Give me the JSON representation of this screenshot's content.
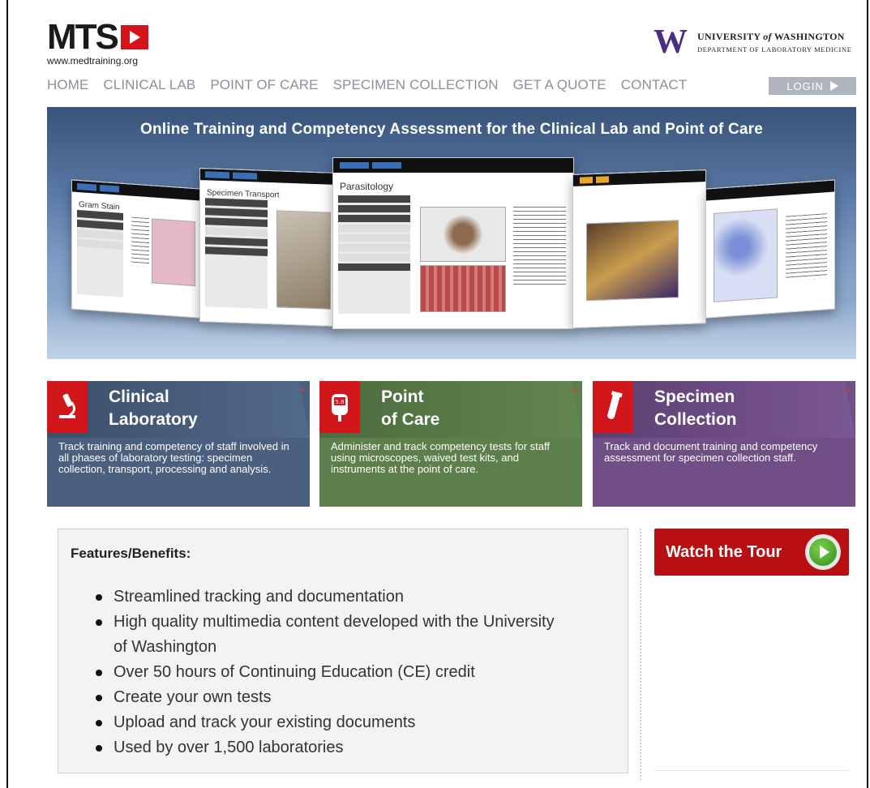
{
  "header": {
    "logo_text": "MTS",
    "logo_url": "www.medtraining.org",
    "uw_mark": "W",
    "uw_name_pre": "UNIVERSITY ",
    "uw_name_of": "of",
    "uw_name_post": " WASHINGTON",
    "uw_dept": "DEPARTMENT OF LABORATORY MEDICINE"
  },
  "nav": {
    "items": [
      "HOME",
      "CLINICAL LAB",
      "POINT OF CARE",
      "SPECIMEN COLLECTION",
      "GET A QUOTE",
      "CONTACT"
    ],
    "login_label": "LOGIN"
  },
  "hero": {
    "title": "Online Training and Competency Assessment for the Clinical Lab and Point of Care",
    "screens": [
      "Gram Stain",
      "Specimen Transport",
      "Parasitology"
    ]
  },
  "tiles": [
    {
      "title_1": "Clinical",
      "title_2": "Laboratory",
      "icon": "microscope-icon",
      "desc": "Track training and competency of staff involved in all phases of laboratory testing: specimen collection, transport, processing and analysis."
    },
    {
      "title_1": "Point",
      "title_2": "of Care",
      "icon": "glucometer-icon",
      "icon_text": "5.8",
      "desc": "Administer and track competency tests for staff using microscopes, waived test kits, and instruments at the point of care."
    },
    {
      "title_1": "Specimen",
      "title_2": "Collection",
      "icon": "test-tube-icon",
      "desc": "Track and document training and competency assessment for specimen collection staff."
    }
  ],
  "features": {
    "heading": "Features/Benefits:",
    "items": [
      "Streamlined tracking and documentation",
      "High quality multimedia content developed with the University of Washington",
      "Over 50 hours of Continuing Education (CE) credit",
      "Create your own tests",
      "Upload and track your existing documents",
      "Used by over 1,500 laboratories"
    ]
  },
  "tour": {
    "label": "Watch the Tour"
  },
  "colors": {
    "brand_red": "#d4141a",
    "nav_gray": "#8a9199",
    "clinical": "#4a607e",
    "point_of_care": "#5d7f4c",
    "specimen": "#6f4f86",
    "uw_purple": "#4b2e83"
  }
}
